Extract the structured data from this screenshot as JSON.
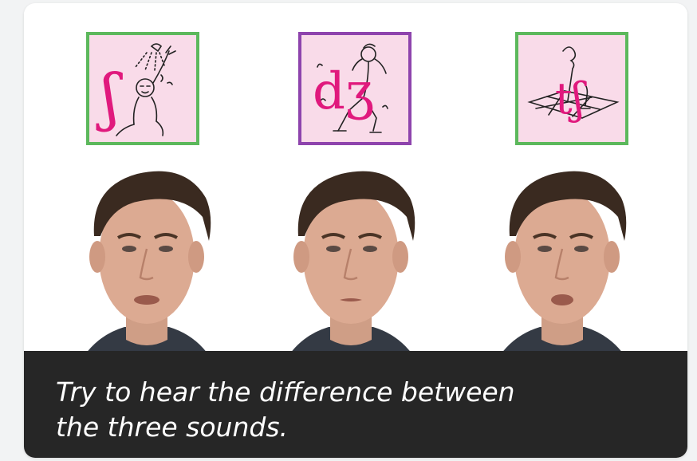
{
  "symbols": [
    {
      "ipa": "ʃ",
      "illustration": "shower-icon",
      "border_color": "#5cb85c"
    },
    {
      "ipa": "dʒ",
      "illustration": "jazz-dancer-icon",
      "border_color": "#8e44ad"
    },
    {
      "ipa": "tʃ",
      "illustration": "chess-piece-icon",
      "border_color": "#5cb85c"
    }
  ],
  "caption": {
    "line1": "Try to hear the difference between",
    "line2": "the three sounds."
  },
  "colors": {
    "symbol_pink": "#e0197d",
    "box_background": "#f9dbe9",
    "caption_background": "#262626"
  }
}
